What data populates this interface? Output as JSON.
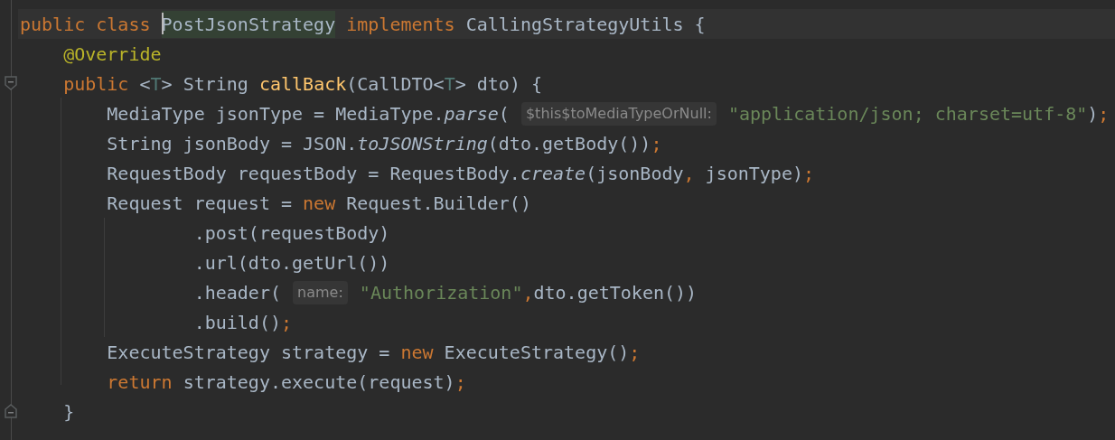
{
  "editor": {
    "lines": [
      {
        "tokens": [
          {
            "kind": "keyword",
            "text": "public class "
          },
          {
            "kind": "highlighted",
            "caret": true,
            "text": "PostJsonStrategy"
          },
          {
            "kind": "keyword",
            "text": " implements "
          },
          {
            "kind": "plain",
            "text": "CallingStrategyUtils {"
          }
        ]
      },
      {
        "tokens": [
          {
            "kind": "annotation",
            "text": "    @Override"
          }
        ]
      },
      {
        "fold": true,
        "tokens": [
          {
            "kind": "keyword",
            "text": "    public "
          },
          {
            "kind": "plain",
            "text": "<"
          },
          {
            "kind": "typeparam",
            "text": "T"
          },
          {
            "kind": "plain",
            "text": "> String "
          },
          {
            "kind": "method",
            "text": "callBack"
          },
          {
            "kind": "plain",
            "text": "(CallDTO<"
          },
          {
            "kind": "typeparam",
            "text": "T"
          },
          {
            "kind": "plain",
            "text": "> dto) {"
          }
        ]
      },
      {
        "tokens": [
          {
            "kind": "plain",
            "text": "        MediaType jsonType = MediaType."
          },
          {
            "kind": "static",
            "text": "parse"
          },
          {
            "kind": "plain",
            "text": "( "
          },
          {
            "kind": "hint",
            "text": "$this$toMediaTypeOrNull:"
          },
          {
            "kind": "string",
            "text": " \"application/json; charset=utf-8\""
          },
          {
            "kind": "plain",
            "text": ")"
          },
          {
            "kind": "keyword",
            "text": ";"
          }
        ]
      },
      {
        "tokens": [
          {
            "kind": "plain",
            "text": "        String jsonBody = JSON."
          },
          {
            "kind": "static",
            "text": "toJSONString"
          },
          {
            "kind": "plain",
            "text": "(dto.getBody())"
          },
          {
            "kind": "keyword",
            "text": ";"
          }
        ]
      },
      {
        "tokens": [
          {
            "kind": "plain",
            "text": "        RequestBody requestBody = RequestBody."
          },
          {
            "kind": "static",
            "text": "create"
          },
          {
            "kind": "plain",
            "text": "(jsonBody"
          },
          {
            "kind": "keyword",
            "text": ", "
          },
          {
            "kind": "plain",
            "text": "jsonType)"
          },
          {
            "kind": "keyword",
            "text": ";"
          }
        ]
      },
      {
        "tokens": [
          {
            "kind": "plain",
            "text": "        Request request = "
          },
          {
            "kind": "keyword",
            "text": "new "
          },
          {
            "kind": "plain",
            "text": "Request.Builder()"
          }
        ]
      },
      {
        "tokens": [
          {
            "kind": "plain",
            "text": "                .post(requestBody)"
          }
        ]
      },
      {
        "tokens": [
          {
            "kind": "plain",
            "text": "                .url(dto.getUrl())"
          }
        ]
      },
      {
        "tokens": [
          {
            "kind": "plain",
            "text": "                .header( "
          },
          {
            "kind": "hint",
            "text": "name:"
          },
          {
            "kind": "string",
            "text": " \"Authorization\""
          },
          {
            "kind": "keyword",
            "text": ","
          },
          {
            "kind": "plain",
            "text": "dto.getToken())"
          }
        ]
      },
      {
        "tokens": [
          {
            "kind": "plain",
            "text": "                .build()"
          },
          {
            "kind": "keyword",
            "text": ";"
          }
        ]
      },
      {
        "tokens": [
          {
            "kind": "plain",
            "text": "        ExecuteStrategy strategy = "
          },
          {
            "kind": "keyword",
            "text": "new "
          },
          {
            "kind": "plain",
            "text": "ExecuteStrategy()"
          },
          {
            "kind": "keyword",
            "text": ";"
          }
        ]
      },
      {
        "tokens": [
          {
            "kind": "keyword",
            "text": "        return "
          },
          {
            "kind": "plain",
            "text": "strategy.execute(request)"
          },
          {
            "kind": "keyword",
            "text": ";"
          }
        ]
      },
      {
        "fold": true,
        "tokens": [
          {
            "kind": "plain",
            "text": "    }"
          }
        ]
      }
    ]
  }
}
